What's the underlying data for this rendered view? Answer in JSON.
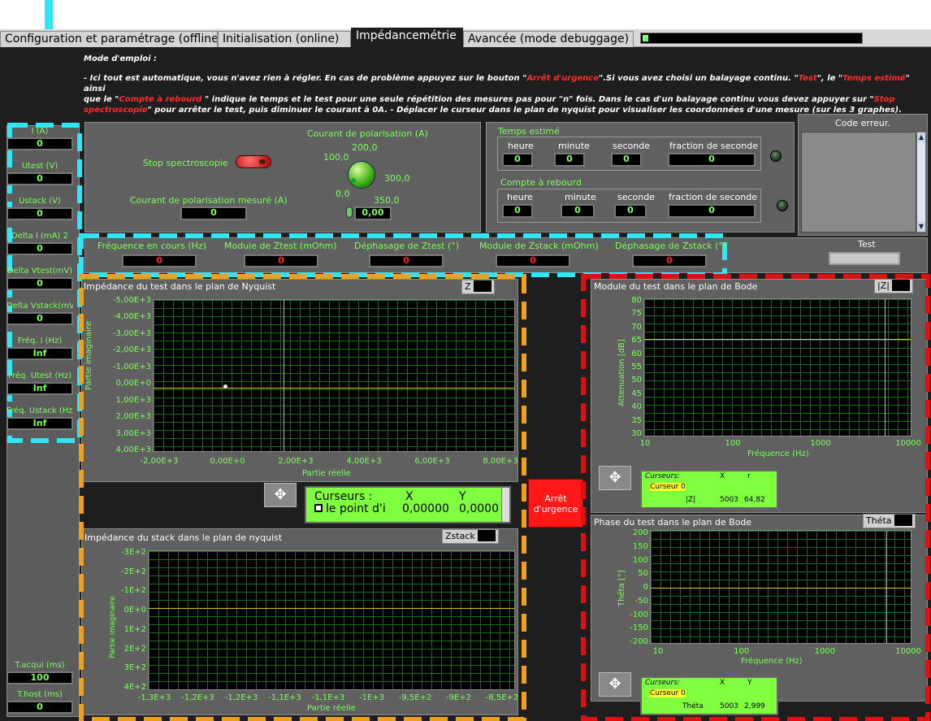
{
  "tabs": [
    "Configuration et paramétrage (offline)",
    "Initialisation (online)",
    "Impédancemétrie",
    "Avancée (mode debuggage)"
  ],
  "instructions": {
    "title": "Mode d'emploi :",
    "p1a": "- Ici tout est automatique, vous n'avez rien à régler. En cas de problème appuyez sur le bouton  \"",
    "p1b": "Arrêt d'urgence",
    "p1c": "\".Si vous avez choisi un balayage continu. \"",
    "p1d": "Test",
    "p1e": "\", le \"",
    "p1f": "Temps estimé",
    "p1g": "\" ainsi",
    "p2a": "que le \"",
    "p2b": "Compte à rebourd",
    "p2c": " \" indique le temps et le test  pour une seule répétition des mesures pas pour \"n\" fois. Dans le cas d'un balayage continu vous devez appuyer sur \"",
    "p2d": "Stop",
    "p3a": "spectroscopie",
    "p3b": "\" pour arrêter le test, puis diminuer le courant à 0A. - Déplacer le curseur dans le plan de nyquist pour visualiser les coordonnées d'une mesure (sur les 3 graphes)."
  },
  "left": [
    {
      "label": "I (A)",
      "value": "0"
    },
    {
      "label": "Utest (V)",
      "value": "0"
    },
    {
      "label": "Ustack (V)",
      "value": "0"
    },
    {
      "label": "Delta I (mA) 2",
      "value": "0"
    },
    {
      "label": "Delta Vtest(mV)",
      "value": "0"
    },
    {
      "label": "Delta Vstack(mV)",
      "value": "0"
    },
    {
      "label": "Fréq. I (Hz)",
      "value": "Inf"
    },
    {
      "label": "Fréq. Utest (Hz)",
      "value": "Inf"
    },
    {
      "label": "Fréq. Ustack (Hz)",
      "value": "Inf"
    }
  ],
  "tacq": {
    "label": "T.acqui (ms)",
    "value": "100"
  },
  "thost": {
    "label": "T.host (ms)",
    "value": "0"
  },
  "polar": {
    "stop_label": "Stop spectroscopie",
    "knob_title": "Courant de polarisation (A)",
    "knob_scale": [
      "0,0",
      "100,0",
      "200,0",
      "300,0",
      "350,0"
    ],
    "knob_value": "0,00",
    "measured_label": "Courant de polarisation mesuré (A)",
    "measured_value": "0"
  },
  "temps": {
    "title": "Temps estimé",
    "cols": [
      "heure",
      "minute",
      "seconde",
      "fraction de seconde"
    ],
    "vals": [
      "0",
      "0",
      "0",
      "0"
    ]
  },
  "compte": {
    "title": "Compte à rebourd",
    "cols": [
      "heure",
      "minute",
      "seconde",
      "fraction de seconde"
    ],
    "vals": [
      "0",
      "0",
      "0",
      "0"
    ]
  },
  "code_erreur": "Code erreur.",
  "test_label": "Test",
  "freqrow": [
    {
      "label": "Fréquence en cours (Hz)",
      "value": "0"
    },
    {
      "label": "Module de Ztest (mOhm)",
      "value": "0"
    },
    {
      "label": "Déphasage de Ztest (°)",
      "value": "0"
    },
    {
      "label": "Module de Zstack (mOhm)",
      "value": "0"
    },
    {
      "label": "Déphasage de Zstack (°)",
      "value": "0"
    }
  ],
  "nyq_test": {
    "title": "Impédance du test  dans le plan de Nyquist",
    "btn": "Z",
    "ylabel": "Partie imaginaire",
    "xlabel": "Partie réelle",
    "yticks": [
      "-5,00E+3",
      "-4,00E+3",
      "-3,00E+3",
      "-2,00E+3",
      "-1,00E+3",
      "0,00E+0",
      "1,00E+3",
      "2,00E+3",
      "3,00E+3",
      "4,00E+3"
    ],
    "xticks": [
      "-2,00E+3",
      "0,00E+0",
      "2,00E+3",
      "4,00E+3",
      "6,00E+3",
      "8,00E+3"
    ]
  },
  "cursor_test": {
    "h1": "Curseurs :",
    "h2": "X",
    "h3": "Y",
    "name": "le point d'i",
    "x": "0,00000",
    "y": "0,0000"
  },
  "arret": "Arrêt d'urgence",
  "nyq_stack": {
    "title": "Impédance du stack dans le plan de nyquist",
    "btn": "Zstack",
    "ylabel": "Partie imaginaire",
    "xlabel": "Partie réelle",
    "yticks": [
      "-3E+2",
      "-2E+2",
      "-1E+2",
      "0E+0",
      "1E+2",
      "2E+2",
      "3E+2",
      "4E+2"
    ],
    "xticks": [
      "-1,3E+3",
      "-1,2E+3",
      "-1,2E+3",
      "-1,1E+3",
      "-1,1E+3",
      "-1E+3",
      "-9,5E+2",
      "-9E+2",
      "-8,5E+2"
    ]
  },
  "bode_mod": {
    "title": "Module du test dans le plan de Bode",
    "btn": "|Z|",
    "ylabel": "Attenuation [dB]",
    "xlabel": "Fréquence (Hz)",
    "yticks": [
      "80",
      "75",
      "70",
      "65",
      "60",
      "55",
      "50",
      "45",
      "40",
      "35",
      "30"
    ],
    "xticks": [
      "10",
      "100",
      "1000",
      "10000"
    ]
  },
  "cursor_mod": {
    "h1": "Curseurs:",
    "h2": "X",
    "h3": "r",
    "name": "Curseur 0",
    "sub": "|Z|",
    "x": "5003",
    "y": "64,82"
  },
  "bode_phase": {
    "title": "Phase du test dans le plan de Bode",
    "btn": "Théta",
    "ylabel": "Théta [°]",
    "xlabel": "Fréquence (Hz)",
    "yticks": [
      "200",
      "150",
      "100",
      "50",
      "0",
      "-50",
      "-100",
      "-150",
      "-200"
    ],
    "xticks": [
      "10",
      "100",
      "1000",
      "10000"
    ]
  },
  "cursor_phase": {
    "h1": "Curseurs:",
    "h2": "X",
    "h3": "Y",
    "name": "Curseur 0",
    "sub": "Théta",
    "x": "5003",
    "y": "2,999"
  },
  "colors": {
    "arrow": "#2ee6f5",
    "cyan_dash": "#2ee6f5",
    "orange_dash": "#f0a020",
    "red_dash": "#e01010",
    "green_text": "#7cff5c"
  }
}
